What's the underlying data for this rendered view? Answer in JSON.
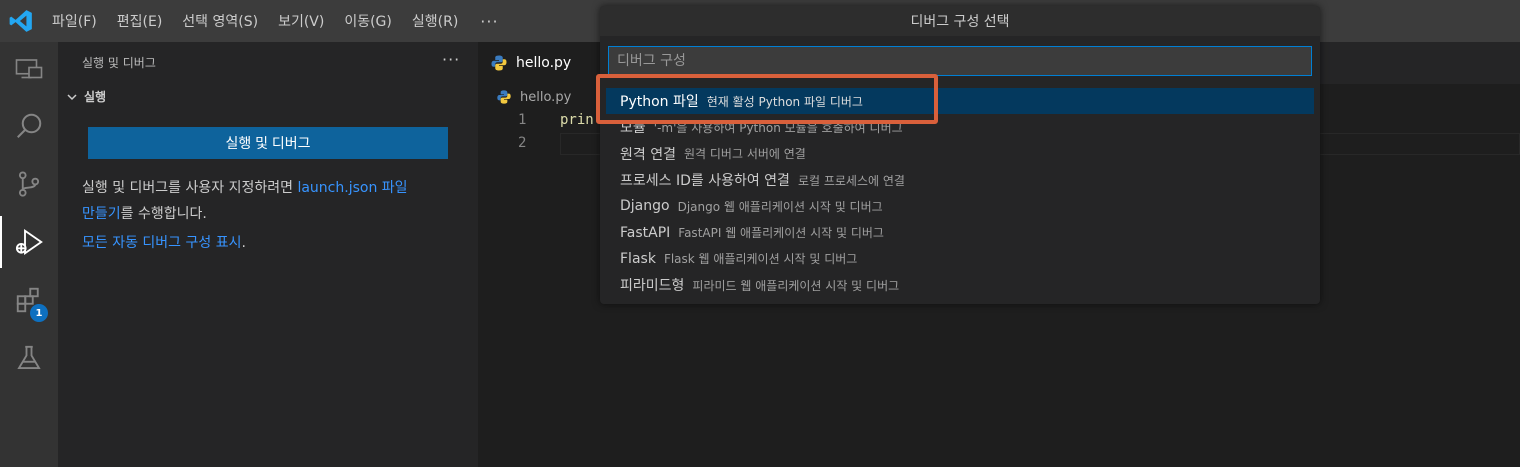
{
  "menubar": {
    "logo_icon": "vscode-logo-icon",
    "items": [
      "파일(F)",
      "편집(E)",
      "선택 영역(S)",
      "보기(V)",
      "이동(G)",
      "실행(R)"
    ],
    "more": "···"
  },
  "activitybar": {
    "items": [
      {
        "name": "remote-explorer-icon"
      },
      {
        "name": "search-icon"
      },
      {
        "name": "source-control-icon"
      },
      {
        "name": "run-debug-icon",
        "active": true
      },
      {
        "name": "extensions-icon",
        "badge": "1"
      },
      {
        "name": "testing-icon"
      }
    ]
  },
  "sidebar": {
    "title": "실행 및 디버그",
    "more": "···",
    "section": "실행",
    "run_button": "실행 및 디버그",
    "text_before_link": "실행 및 디버그를 사용자 지정하려면 ",
    "link1_a": "launch.json 파일",
    "link1_b": "만들기",
    "text_after_link": "를 수행합니다.",
    "link2": "모든 자동 디버그 구성 표시",
    "link2_suffix": "."
  },
  "editor": {
    "tab_label": "hello.py",
    "breadcrumb": "hello.py",
    "line_numbers": [
      "1",
      "2"
    ],
    "code_line1": "prin"
  },
  "quickpick": {
    "title": "디버그 구성 선택",
    "input_placeholder": "디버그 구성",
    "items": [
      {
        "label": "Python 파일",
        "description": "현재 활성 Python 파일 디버그"
      },
      {
        "label": "모듈",
        "description": "'-m'을 사용하여 Python 모듈을 호출하여 디버그"
      },
      {
        "label": "원격 연결",
        "description": "원격 디버그 서버에 연결"
      },
      {
        "label": "프로세스 ID를 사용하여 연결",
        "description": "로컬 프로세스에 연결"
      },
      {
        "label": "Django",
        "description": "Django 웹 애플리케이션 시작 및 디버그"
      },
      {
        "label": "FastAPI",
        "description": "FastAPI 웹 애플리케이션 시작 및 디버그"
      },
      {
        "label": "Flask",
        "description": "Flask 웹 애플리케이션 시작 및 디버그"
      },
      {
        "label": "피라미드형",
        "description": "피라미드 웹 애플리케이션 시작 및 디버그"
      }
    ]
  },
  "colors": {
    "accent": "#007fd4",
    "selection": "#04395e",
    "highlight_box": "#d9603b",
    "button": "#0e639c"
  }
}
